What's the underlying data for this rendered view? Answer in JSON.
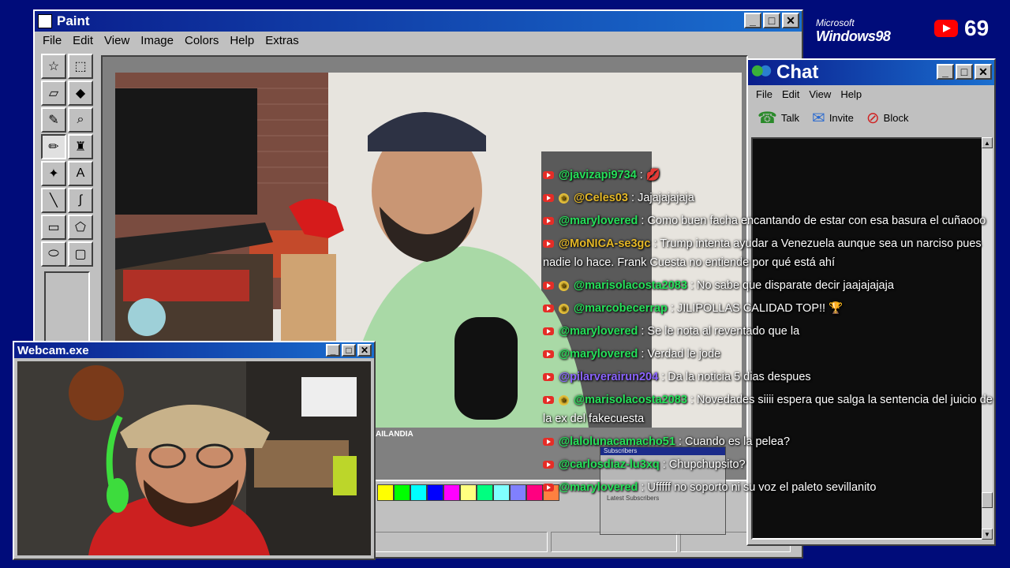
{
  "paint": {
    "title": "Paint",
    "menu": [
      "File",
      "Edit",
      "View",
      "Image",
      "Colors",
      "Help",
      "Extras"
    ],
    "palette": [
      "#ffff00",
      "#00ff00",
      "#00ffff",
      "#0000ff",
      "#ff00ff",
      "#ffff80",
      "#00ff80",
      "#80ffff",
      "#8080ff",
      "#ff0080",
      "#ff8040"
    ],
    "overlay_text": "AILANDIA"
  },
  "webcam": {
    "title": "Webcam.exe"
  },
  "chat_window": {
    "title": "Chat",
    "menu": [
      "File",
      "Edit",
      "View",
      "Help"
    ],
    "tools": [
      {
        "label": "Talk",
        "icon": "talk-icon"
      },
      {
        "label": "Invite",
        "icon": "invite-icon"
      },
      {
        "label": "Block",
        "icon": "block-icon"
      }
    ]
  },
  "counter": {
    "value": "69"
  },
  "logo": {
    "microsoft": "Microsoft",
    "windows": "Windows98"
  },
  "subscribers_mini": {
    "title": "Subscribers",
    "label": "Latest Subscribers"
  },
  "messages": [
    {
      "user": "@javizapi9734",
      "color": "green",
      "star": false,
      "text": "",
      "emoji": "💋"
    },
    {
      "user": "@Celes03",
      "color": "yellow",
      "star": true,
      "text": "Jajajajajaja"
    },
    {
      "user": "@marylovered",
      "color": "green",
      "star": false,
      "text": "Como buen facha encantando de estar con esa basura el cuñaooo"
    },
    {
      "user": "@MoNICA-se3gc",
      "color": "yellow",
      "star": false,
      "text": "Trump intenta ayudar a Venezuela aunque sea un narciso pues nadie lo hace. Frank Cuesta no entiende por qué está ahí"
    },
    {
      "user": "@marisolacosta2083",
      "color": "green",
      "star": true,
      "text": "No sabe que disparate decir jaajajajaja"
    },
    {
      "user": "@marcobecerrap",
      "color": "green",
      "star": true,
      "text": "JILIPOLLAS CALIDAD TOP!! 🏆"
    },
    {
      "user": "@marylovered",
      "color": "green",
      "star": false,
      "text": "Se le nota al reventado que la"
    },
    {
      "user": "@marylovered",
      "color": "green",
      "star": false,
      "text": "Verdad le jode"
    },
    {
      "user": "@pilarverairun204",
      "color": "purple",
      "star": false,
      "text": "Da la noticia 5 dias despues"
    },
    {
      "user": "@marisolacosta2083",
      "color": "green",
      "star": true,
      "text": "Novedades siiii espera que salga la sentencia del juicio de la ex del fakecuesta"
    },
    {
      "user": "@lalolunacamacho51",
      "color": "green",
      "star": false,
      "text": "Cuando es la pelea?"
    },
    {
      "user": "@carlosdiaz-lu3xq",
      "color": "green",
      "star": false,
      "text": "Chupchupsito?"
    },
    {
      "user": "@marylovered",
      "color": "green",
      "star": false,
      "text": "Ufffff no soporto ni su voz el paleto sevillanito"
    }
  ]
}
